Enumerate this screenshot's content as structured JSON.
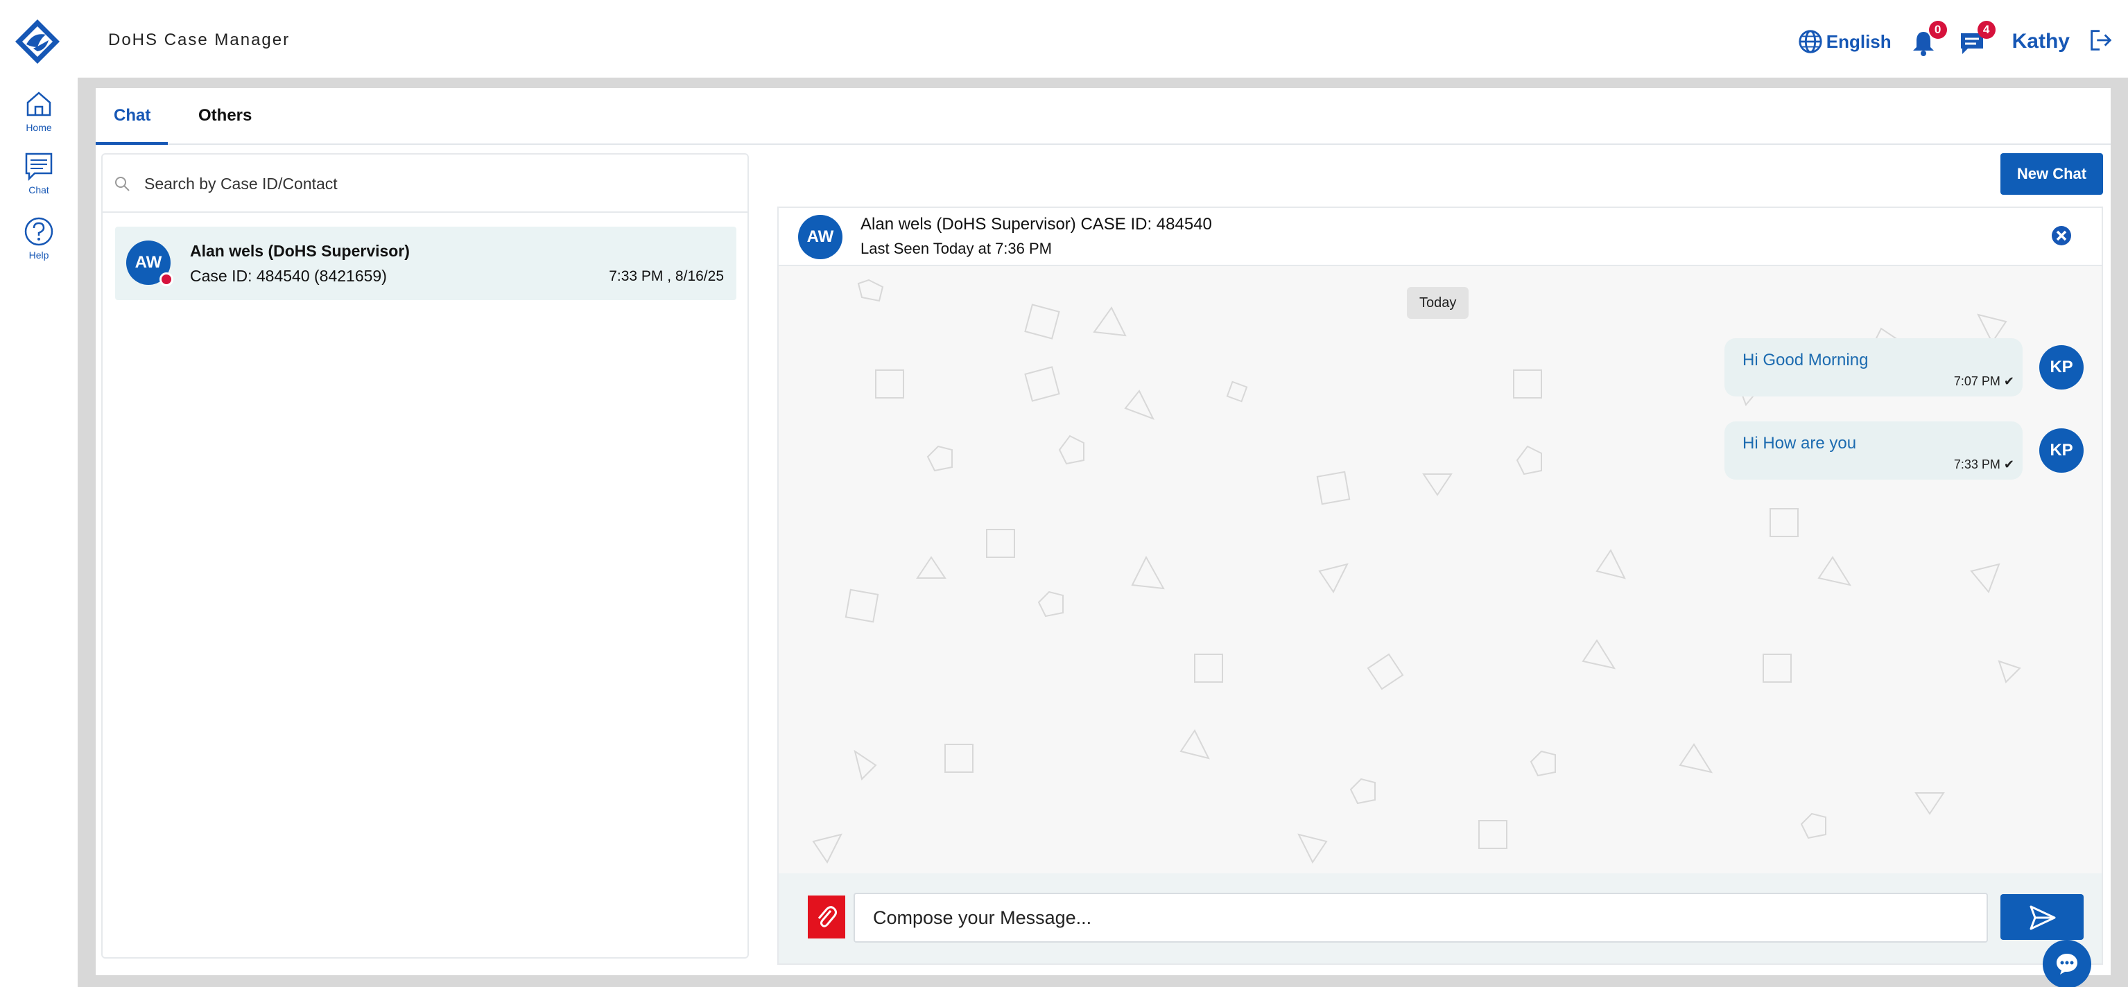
{
  "app": {
    "title": "DoHS Case Manager",
    "language": "English",
    "notifications_count": "0",
    "messages_count": "4",
    "user_name": "Kathy"
  },
  "nav": {
    "home": "Home",
    "chat": "Chat",
    "help": "Help"
  },
  "tabs": {
    "chat": "Chat",
    "others": "Others"
  },
  "search": {
    "placeholder": "Search by Case ID/Contact"
  },
  "contacts": [
    {
      "initials": "AW",
      "name": "Alan wels (DoHS Supervisor)",
      "case": "Case ID: 484540 (8421659)",
      "time": "7:33 PM , 8/16/25"
    }
  ],
  "chat": {
    "new_chat_label": "New Chat",
    "header_initials": "AW",
    "header_title": "Alan wels (DoHS Supervisor) CASE ID: 484540",
    "header_last_seen": "Last Seen Today at 7:36 PM",
    "date_chip": "Today",
    "messages": [
      {
        "text": "Hi Good Morning",
        "time": "7:07 PM ✔",
        "initials": "KP"
      },
      {
        "text": "Hi How are you",
        "time": "7:33 PM ✔",
        "initials": "KP"
      }
    ],
    "compose_placeholder": "Compose your Message..."
  },
  "colors": {
    "primary": "#0f5db7",
    "accent_red": "#d6123c",
    "bubble_bg": "#e8f1f2"
  }
}
